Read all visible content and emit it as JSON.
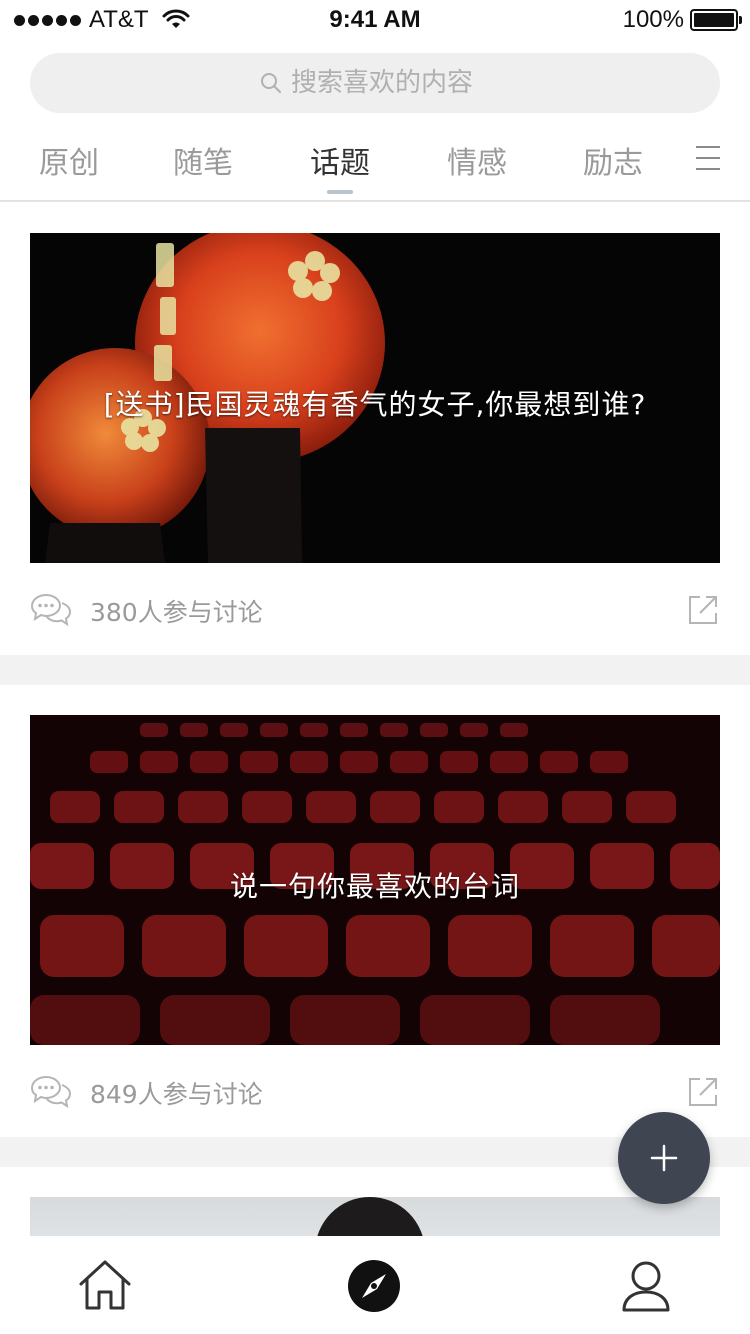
{
  "status_bar": {
    "carrier": "AT&T",
    "time": "9:41 AM",
    "battery": "100%"
  },
  "search": {
    "placeholder": "搜索喜欢的内容"
  },
  "tabs": [
    {
      "label": "原创",
      "active": false
    },
    {
      "label": "随笔",
      "active": false
    },
    {
      "label": "话题",
      "active": true
    },
    {
      "label": "情感",
      "active": false
    },
    {
      "label": "励志",
      "active": false
    }
  ],
  "cards": [
    {
      "title": "[送书]民国灵魂有香气的女子,你最想到谁?",
      "count": "380人参与讨论"
    },
    {
      "title": "说一句你最喜欢的台词",
      "count": "849人参与讨论"
    }
  ],
  "icons": {
    "tab_menu": "menu-icon",
    "comment": "comment-icon",
    "share": "share-icon",
    "fab": "plus-icon",
    "nav": [
      "home-icon",
      "compass-icon",
      "user-icon"
    ]
  },
  "colors": {
    "fab": "#3f4551",
    "active_tab_underline": "#b9c3cc",
    "section_gap": "#f2f2f2"
  }
}
